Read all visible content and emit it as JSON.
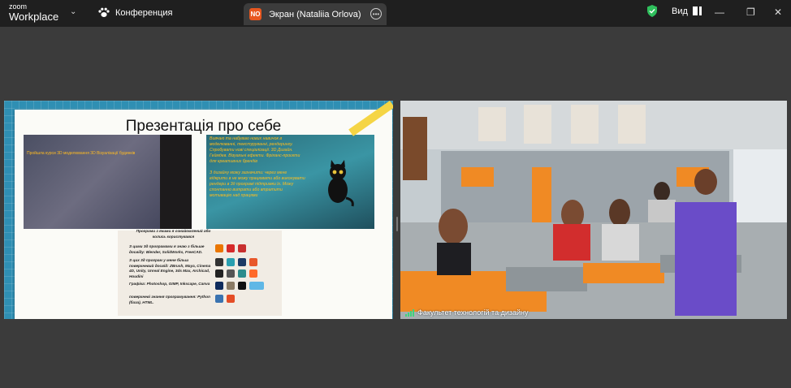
{
  "app": {
    "logo_line1": "zoom",
    "logo_line2": "Workplace"
  },
  "meeting": {
    "icon": "paw-icon",
    "title": "Конференция"
  },
  "screen_tab": {
    "initials": "NO",
    "label": "Экран (Nataliia Orlova)"
  },
  "toolbar": {
    "view_label": "Вид",
    "shield_icon": "shield-check-icon"
  },
  "slide": {
    "title": "Презентація про себе",
    "left_image_text": "Пройшла курси 3D моделювання 3D Візуалізації будинків",
    "right_image_text": "Вивчаю та набуваю нових навичок в моделюванні, текстуруванні, рендерингу. Спробувати нові спеціалізації. 3D Дизайн. Геймдев. Візуальні ефекти. Фріланс-проєкти для креативних брендів",
    "right_image_text2": "З дизайну можу зазначити: через мене відкрити в не можу працювати або виконувати рендери в 3д програмі підтримки їх. Можу спонтанно витрати або втратити мотивацію над працями",
    "programs_intro": "Програми з якими я ознайомлений або колись користувався",
    "programs_3d": "З цими 3д програмами я знаю з більше досвіду: Blender, SolidWorks, FreeCAD.",
    "programs_3d_more": "З цих 3д програм у мене більш поверхневий досвід: ZBrush, Maya, Cinema 4D, Unity, Unreal Engine, 3ds Max, Archicad, Houdini",
    "programs_graphics": "Графіка: Photoshop, GIMP, Inkscape, Canva",
    "programs_code": "поверхневі знання програмування: Python (база), HTML."
  },
  "video": {
    "participant_name": "Факультет технологій та дизайну"
  },
  "colors": {
    "slide_bg": "#2f8fb3",
    "title_bar": "#1f1f1f",
    "stage_bg": "#3b3b3b",
    "tab_badge": "#e8571f",
    "shield": "#2fbf5c"
  }
}
